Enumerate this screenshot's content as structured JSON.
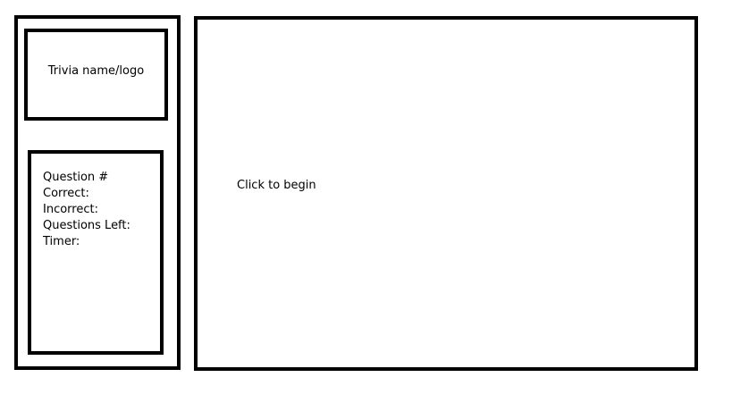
{
  "sidebar": {
    "logo_text": "Trivia name/logo",
    "stats": {
      "question_number_label": "Question #",
      "correct_label": "Correct:",
      "incorrect_label": "Incorrect:",
      "questions_left_label": "Questions Left:",
      "timer_label": "Timer:"
    }
  },
  "main": {
    "start_prompt": "Click to begin"
  },
  "colors": {
    "border": "#000000",
    "background": "#ffffff",
    "text": "#000000"
  }
}
